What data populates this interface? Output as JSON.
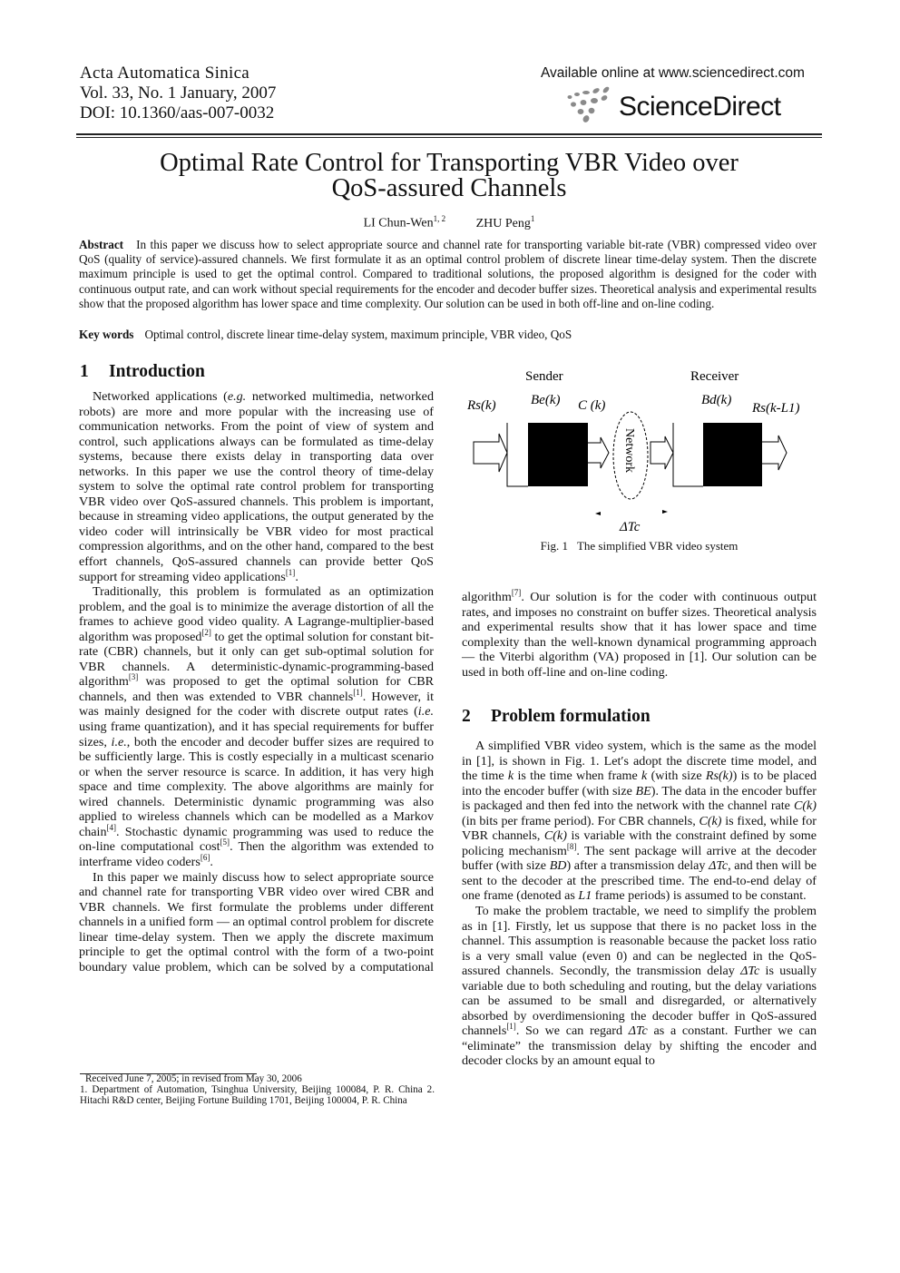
{
  "header": {
    "journal_name": "Acta Automatica Sinica",
    "volume_line": "Vol. 33, No. 1 January, 2007",
    "doi_line": "DOI: 10.1360/aas-007-0032",
    "availability": "Available online at www.sciencedirect.com",
    "publisher_logo_text": "ScienceDirect"
  },
  "paper": {
    "title_line1": "Optimal Rate Control for Transporting VBR Video over",
    "title_line2": "QoS-assured Channels",
    "authors": [
      {
        "name": "LI Chun-Wen",
        "affiliation_marks": "1, 2"
      },
      {
        "name": "ZHU Peng",
        "affiliation_marks": "1"
      }
    ],
    "abstract_label": "Abstract",
    "abstract_text": "In this paper we discuss how to select appropriate source and channel rate for transporting variable bit-rate (VBR) compressed video over QoS (quality of service)-assured channels. We first formulate it as an optimal control problem of discrete linear time-delay system. Then the discrete maximum principle is used to get the optimal control. Compared to traditional solutions, the proposed algorithm is designed for the coder with continuous output rate, and can work without special requirements for the encoder and decoder buffer sizes. Theoretical analysis and experimental results show that the proposed algorithm has lower space and time complexity. Our solution can be used in both off-line and on-line coding.",
    "keywords_label": "Key words",
    "keywords_text": "Optimal control, discrete linear time-delay system, maximum principle, VBR video, QoS"
  },
  "sections": {
    "intro": {
      "number": "1",
      "title": "Introduction",
      "p1": {
        "a": "Networked applications (",
        "eg": "e.g.",
        "b": " networked multimedia, networked robots) are more and more popular with the increasing use of communication networks. From the point of view of system and control, such applications always can be formulated as time-delay systems, because there exists delay in transporting data over networks. In this paper we use the control theory of time-delay system to solve the optimal rate control problem for transporting VBR video over QoS-assured channels. This problem is important, because in streaming video applications, the output generated by the video coder will intrinsically be VBR video for most practical compression algorithms, and on the other hand, compared to the best effort channels, QoS-assured channels can provide better QoS support for streaming video applications",
        "cite1": "[1]",
        "end": "."
      },
      "p2": {
        "a": "Traditionally, this problem is formulated as an optimization problem, and the goal is to minimize the average distortion of all the frames to achieve good video quality. A Lagrange-multiplier-based algorithm was proposed",
        "cite2": "[2]",
        "b": " to get the optimal solution for constant bit-rate (CBR) channels, but it only can get sub-optimal solution for VBR channels. A deterministic-dynamic-programming-based algorithm",
        "cite3": "[3]",
        "c": " was proposed to get the optimal solution for CBR channels, and then was extended to VBR channels",
        "cite4": "[1]",
        "d": ". However, it was mainly designed for the coder with discrete output rates (",
        "ie1": "i.e.",
        "e": " using frame quantization), and it has special requirements for buffer sizes, ",
        "ie2": "i.e.",
        "f": ", both the encoder and decoder buffer sizes are required to be sufficiently large. This is costly especially in a multicast scenario or when the server resource is scarce. In addition, it has very high space and time complexity. The above algorithms are mainly for wired channels. Deterministic dynamic programming was also applied to wireless channels which can be modelled as a Markov chain",
        "cite5": "[4]",
        "g": ". Stochastic dynamic programming was used to reduce the on-line computational cost",
        "cite6": "[5]",
        "h": ". Then the algorithm was extended to interframe video coders",
        "cite7": "[6]",
        "end": "."
      },
      "p3": {
        "a": "In this paper we mainly discuss how to select appropriate source and channel rate for transporting VBR video over wired CBR and VBR channels. We first formulate the problems under different channels in a unified form — an optimal control problem for discrete linear time-delay system. Then we apply the discrete maximum principle to get the optimal control with the form of a two-point boundary value problem, which can be solved by a computational algorithm",
        "cite": "[7]",
        "b": ". Our solution is for the coder with continuous output rates, and imposes no constraint on buffer sizes. Theoretical analysis and experimental results show that it has lower space and time complexity than the well-known dynamical programming approach — the Viterbi algorithm (VA) proposed in [1]. Our solution can be used in both off-line and on-line coding."
      }
    },
    "problem": {
      "number": "2",
      "title": "Problem formulation",
      "p1": {
        "a": "A simplified VBR video system, which is the same as the model in [1], is shown in Fig. 1. Let′s adopt the discrete time model, and the time ",
        "k1": "k",
        "b": " is the time when frame ",
        "k2": "k",
        "c": " (with size ",
        "rsk": "Rs(k)",
        "d": ") is to be placed into the encoder buffer (with size ",
        "be": "BE",
        "e": "). The data in the encoder buffer is packaged and then fed into the network with the channel rate ",
        "ck1": "C(k)",
        "f": " (in bits per frame period). For CBR channels, ",
        "ck2": "C(k)",
        "g": " is fixed, while for VBR channels, ",
        "ck3": "C(k)",
        "h": " is variable with the constraint defined by some policing mechanism",
        "cite": "[8]",
        "i": ". The sent package will arrive at the decoder buffer (with size ",
        "bd": "BD",
        "j": ") after a transmission delay ",
        "dtc": "ΔTc",
        "k": ", and then will be sent to the decoder at the prescribed time. The end-to-end delay of one frame (denoted as ",
        "l1": "L1",
        "l": " frame periods) is assumed to be constant."
      },
      "p2": {
        "a": "To make the problem tractable, we need to simplify the problem as in [1]. Firstly, let us suppose that there is no packet loss in the channel. This assumption is reasonable because the packet loss ratio is a very small value (even 0) and can be neglected in the QoS-assured channels. Secondly, the transmission delay ",
        "dtc1": "ΔTc",
        "b": " is usually variable due to both scheduling and routing, but the delay variations can be assumed to be small and disregarded, or alternatively absorbed by overdimensioning the decoder buffer in QoS-assured channels",
        "cite": "[1]",
        "c": ". So we can regard ",
        "dtc2": "ΔTc",
        "d": " as a constant. Further we can “eliminate” the transmission delay by shifting the encoder and decoder clocks by an amount equal to"
      }
    }
  },
  "figure": {
    "label": "Fig. 1",
    "caption": "The simplified VBR video system",
    "sender_label": "Sender",
    "receiver_label": "Receiver",
    "input_label": "Rs(k)",
    "encoder_buffer_label": "Be(k)",
    "channel_rate_label": "C (k)",
    "network_label": "Network",
    "decoder_buffer_label": "Bd(k)",
    "output_label": "Rs(k-L1)",
    "delay_label": "ΔTc"
  },
  "footnotes": {
    "received": "Received June 7, 2005; in revised from May 30, 2006",
    "affiliations": "1. Department of Automation, Tsinghua University, Beijing 100084, P. R. China   2. Hitachi R&D center, Beijing Fortune Building 1701, Beijing 100004, P. R. China"
  }
}
